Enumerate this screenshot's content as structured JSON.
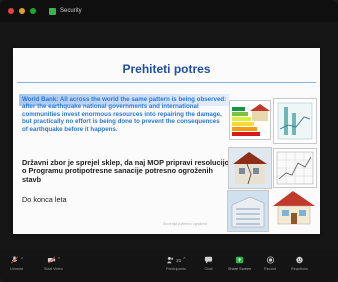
{
  "window": {
    "title": "Security"
  },
  "slide": {
    "title": "Prehiteti potres",
    "world_bank_text": "World Bank: All across the world the same pattern is being observed: after the earthquake national governments and international communities invest enormous resources into repairing the damage, but practically no effort is being done to prevent the consequences of earthquake before it happens.",
    "state_text": "Državni zbor je sprejel sklep, da naj MOP pripravi resolucijo o Programu protipotresne sanacije potresno ogroženih stavb",
    "deadline_text": "Do konca leta",
    "footer_text": "Slovenija potresno ogrožena"
  },
  "toolbar": {
    "items": [
      {
        "label": "Unmute",
        "icon": "microphone-icon",
        "caret": true
      },
      {
        "label": "Start Video",
        "icon": "video-camera-icon",
        "caret": true
      },
      {
        "label": "Participants",
        "icon": "participants-icon",
        "count": "21",
        "caret": true
      },
      {
        "label": "Chat",
        "icon": "chat-icon"
      },
      {
        "label": "Share Screen",
        "icon": "share-screen-icon"
      },
      {
        "label": "Record",
        "icon": "record-icon"
      },
      {
        "label": "Reactions",
        "icon": "reactions-icon"
      }
    ]
  },
  "colors": {
    "accent_green": "#39b54a",
    "slide_title": "#1f4fa3",
    "slide_blue_text": "#2b78d8",
    "background": "#161616"
  }
}
